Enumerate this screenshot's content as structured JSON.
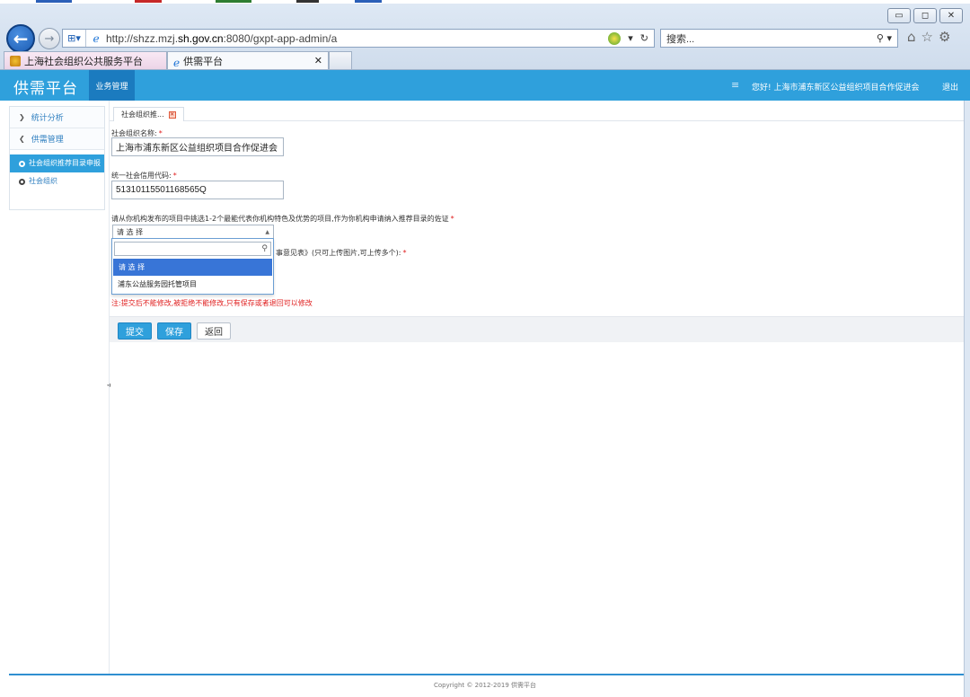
{
  "browser": {
    "address_url_prefix": "http://shzz.mzj.",
    "address_url_domain": "sh.gov.cn",
    "address_url_suffix": ":8080/gxpt-app-admin/a",
    "search_placeholder": "搜索...",
    "tabs": [
      {
        "label": "上海社会组织公共服务平台"
      },
      {
        "label": "供需平台"
      }
    ]
  },
  "header": {
    "brand": "供需平台",
    "nav_tab": "业务管理",
    "user_greeting": "您好! 上海市浦东新区公益组织项目合作促进会",
    "logout": "退出"
  },
  "sidebar": {
    "groups": [
      {
        "label": "统计分析"
      },
      {
        "label": "供需管理"
      }
    ],
    "items": [
      {
        "label": "社会组织推荐目录申报"
      },
      {
        "label": "社会组织"
      }
    ]
  },
  "content": {
    "tab_label": "社会组织推...",
    "fields": {
      "org_name_label": "社会组织名称:",
      "org_name_value": "上海市浦东新区公益组织项目合作促进会",
      "credit_code_label": "统一社会信用代码:",
      "credit_code_value": "51310115501168565Q",
      "project_label": "请从你机构发布的项目中挑选1-2个最能代表你机构特色及优势的项目,作为你机构申请纳入推荐目录的佐证",
      "required_mark": "*"
    },
    "select": {
      "selected": "请 选 择",
      "options": [
        "请 选 择",
        "浦东公益服务园托管项目"
      ]
    },
    "partial_hidden_label": "事意见表》(只可上传图片,可上传多个):",
    "note": "注:提交后不能修改,被拒绝不能修改,只有保存或者退回可以修改",
    "buttons": {
      "submit": "提交",
      "save": "保存",
      "back": "返回"
    }
  },
  "footer": "Copyright © 2012-2019 供需平台",
  "colors": {
    "header_bg": "#2fa0dc",
    "nav_tab_bg": "#1b7bbf",
    "highlight": "#3875d7",
    "required": "#e02020"
  }
}
